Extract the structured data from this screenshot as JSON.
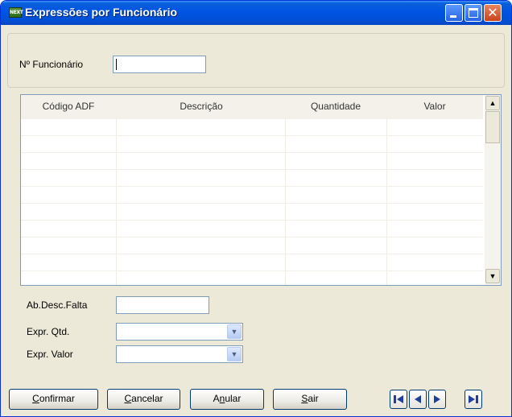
{
  "window": {
    "title": "Expressões por Funcionário",
    "icon_label": "NEXT",
    "icon": "next-app-icon",
    "title_buttons": [
      "minimize-icon",
      "maximize-icon",
      "close-icon"
    ],
    "title_bar_color": "#0054e3"
  },
  "header_panel": {
    "employee_number_label": "Nº Funcionário",
    "employee_number_value": ""
  },
  "grid": {
    "columns": [
      "Código ADF",
      "Descrição",
      "Quantidade",
      "Valor"
    ],
    "rows": []
  },
  "form": {
    "ab_desc_falta_label": "Ab.Desc.Falta",
    "ab_desc_falta_value": "",
    "expr_qtd_label": "Expr. Qtd.",
    "expr_qtd_value": "",
    "expr_valor_label": "Expr. Valor",
    "expr_valor_value": ""
  },
  "buttons": {
    "confirm": {
      "hot": "C",
      "rest": "onfirmar"
    },
    "cancel": {
      "hot": "C",
      "rest": "ancelar"
    },
    "void": {
      "pre": "A",
      "hot": "n",
      "rest": "ular"
    },
    "exit": {
      "hot": "S",
      "rest": "air"
    }
  },
  "navigation": [
    "first-record-icon",
    "previous-record-icon",
    "next-record-icon",
    "last-record-icon"
  ]
}
